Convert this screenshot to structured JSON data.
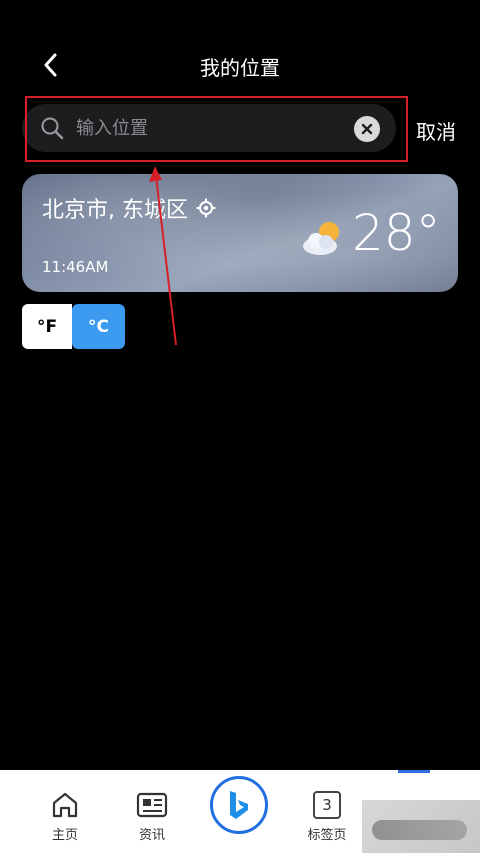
{
  "header": {
    "title": "我的位置"
  },
  "search": {
    "placeholder": "输入位置",
    "value": "",
    "cancel_label": "取消"
  },
  "weather_card": {
    "location": "北京市, 东城区",
    "time": "11:46AM",
    "temperature": "28°",
    "condition_icon": "partly-cloudy-icon"
  },
  "unit_toggle": {
    "fahrenheit_label": "°F",
    "celsius_label": "°C",
    "selected": "celsius"
  },
  "bottom_nav": {
    "items": [
      {
        "label": "主页",
        "icon": "home-icon"
      },
      {
        "label": "资讯",
        "icon": "news-icon"
      },
      {
        "label": "",
        "icon": "bing-icon"
      },
      {
        "label": "标签页",
        "icon": "tabs-icon",
        "count": "3"
      }
    ]
  },
  "colors": {
    "accent": "#3c9bf0",
    "highlight_red": "#d61f26",
    "bing_blue": "#1f6fe0"
  }
}
